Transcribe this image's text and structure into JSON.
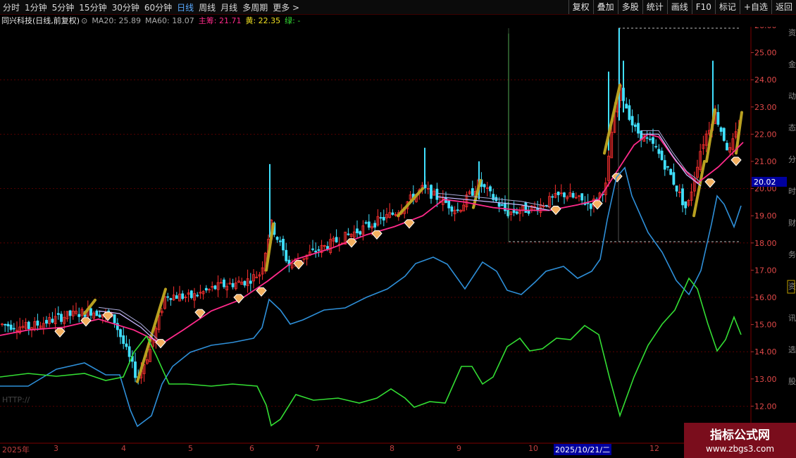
{
  "toolbar": {
    "periods": [
      "分时",
      "1分钟",
      "5分钟",
      "15分钟",
      "30分钟",
      "60分钟",
      "日线",
      "周线",
      "月线",
      "多周期",
      "更多 >"
    ],
    "active_period": "日线",
    "tools": [
      "复权",
      "叠加",
      "多股",
      "统计",
      "画线",
      "F10",
      "标记",
      "+自选",
      "返回"
    ]
  },
  "info": {
    "stock_title": "同兴科技(日线,前复权)",
    "ma20": "MA20: 25.89",
    "ma60": "MA60: 18.07",
    "main": "主筹: 21.71",
    "yellow": "黄: 22.35",
    "green": "绿: -"
  },
  "price_axis": {
    "ticks": [
      "26.00",
      "25.00",
      "24.00",
      "23.00",
      "22.00",
      "21.00",
      "20.00",
      "19.00",
      "18.00",
      "17.00",
      "16.00",
      "15.00",
      "14.00",
      "13.00",
      "12.00"
    ],
    "current_label": "20.02"
  },
  "date_axis": {
    "months": [
      "2025年",
      "3",
      "4",
      "5",
      "6",
      "7",
      "8",
      "9",
      "10",
      "11",
      "12"
    ],
    "cursor_date": "2025/10/21/二"
  },
  "side_text": "资金动态分时财务资讯选股",
  "http_label": "HTTP://",
  "watermark": {
    "title": "指标公式网",
    "url": "www.zbgs3.com"
  },
  "colors": {
    "up": "#ff3030",
    "down": "#40e0ff",
    "ma_pink": "#ff2a8a",
    "blue": "#2e8fd8",
    "green": "#33dd33"
  }
}
